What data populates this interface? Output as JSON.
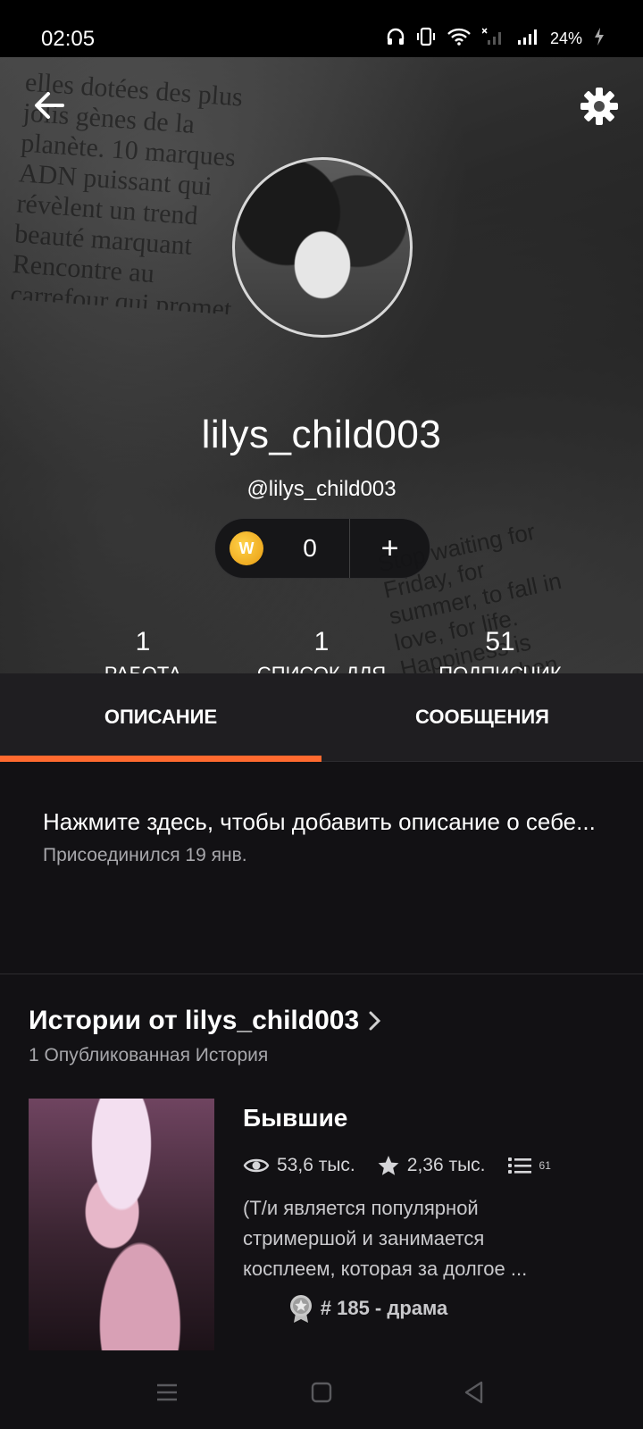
{
  "status_bar": {
    "time": "02:05",
    "battery": "24%"
  },
  "profile": {
    "display_name": "lilys_child003",
    "handle": "@lilys_child003",
    "coins": "0",
    "coin_symbol": "W",
    "stats": [
      {
        "value": "1",
        "label": "РАБОТА"
      },
      {
        "value": "1",
        "label": "СПИСОК ДЛЯ ЧТЕНИЯ"
      },
      {
        "value": "51",
        "label": "ПОДПИСЧИК"
      }
    ]
  },
  "tabs": {
    "active": "ОПИСАНИЕ",
    "other": "СООБЩЕНИЯ",
    "accent": "#ff6a2f"
  },
  "about": {
    "description": "Нажмите здесь, чтобы добавить описание о себе...",
    "joined": "Присоединился 19 янв."
  },
  "stories": {
    "title": "Истории от lilys_child003",
    "count_label": "1 Опубликованная История",
    "items": [
      {
        "title": "Бывшие",
        "reads": "53,6 тыс.",
        "votes": "2,36 тыс.",
        "parts": "61",
        "description": "(Т/и является популярной стримершой и занимается косплеем, которая за долгое ...",
        "rank": "# 185 - драма"
      }
    ]
  },
  "cover_text": {
    "newsprint": "elles dotées des plus jolis gènes de la planète. 10 marques ADN puissant qui révèlent un trend beauté marquant Rencontre au carrefour qui promet de nouvelles perspectives de sélection",
    "note": "Stop waiting for Friday, for summer, to fall in love, for life. Happiness is achieved when you"
  }
}
